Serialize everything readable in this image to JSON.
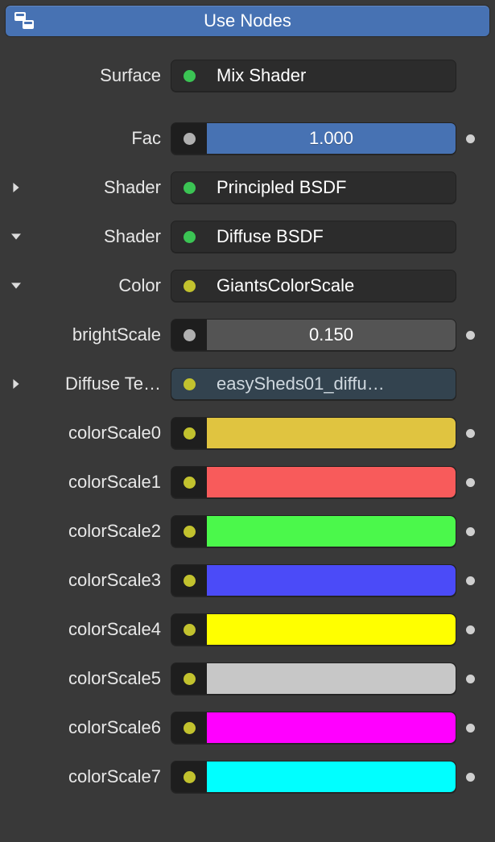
{
  "header": {
    "label": "Use Nodes"
  },
  "surface": {
    "label": "Surface",
    "value": "Mix Shader"
  },
  "fac": {
    "label": "Fac",
    "value": "1.000"
  },
  "shader1": {
    "label": "Shader",
    "value": "Principled BSDF"
  },
  "shader2": {
    "label": "Shader",
    "value": "Diffuse BSDF"
  },
  "colorNode": {
    "label": "Color",
    "value": "GiantsColorScale"
  },
  "brightScale": {
    "label": "brightScale",
    "value": "0.150"
  },
  "diffuseTex": {
    "label": "Diffuse Te…",
    "value": "easySheds01_diffu…"
  },
  "colorScales": [
    {
      "label": "colorScale0",
      "color": "#e0c440"
    },
    {
      "label": "colorScale1",
      "color": "#f85b5b"
    },
    {
      "label": "colorScale2",
      "color": "#4bf84b"
    },
    {
      "label": "colorScale3",
      "color": "#4b4bf8"
    },
    {
      "label": "colorScale4",
      "color": "#ffff00"
    },
    {
      "label": "colorScale5",
      "color": "#c7c7c7"
    },
    {
      "label": "colorScale6",
      "color": "#ff00ff"
    },
    {
      "label": "colorScale7",
      "color": "#00ffff"
    }
  ]
}
